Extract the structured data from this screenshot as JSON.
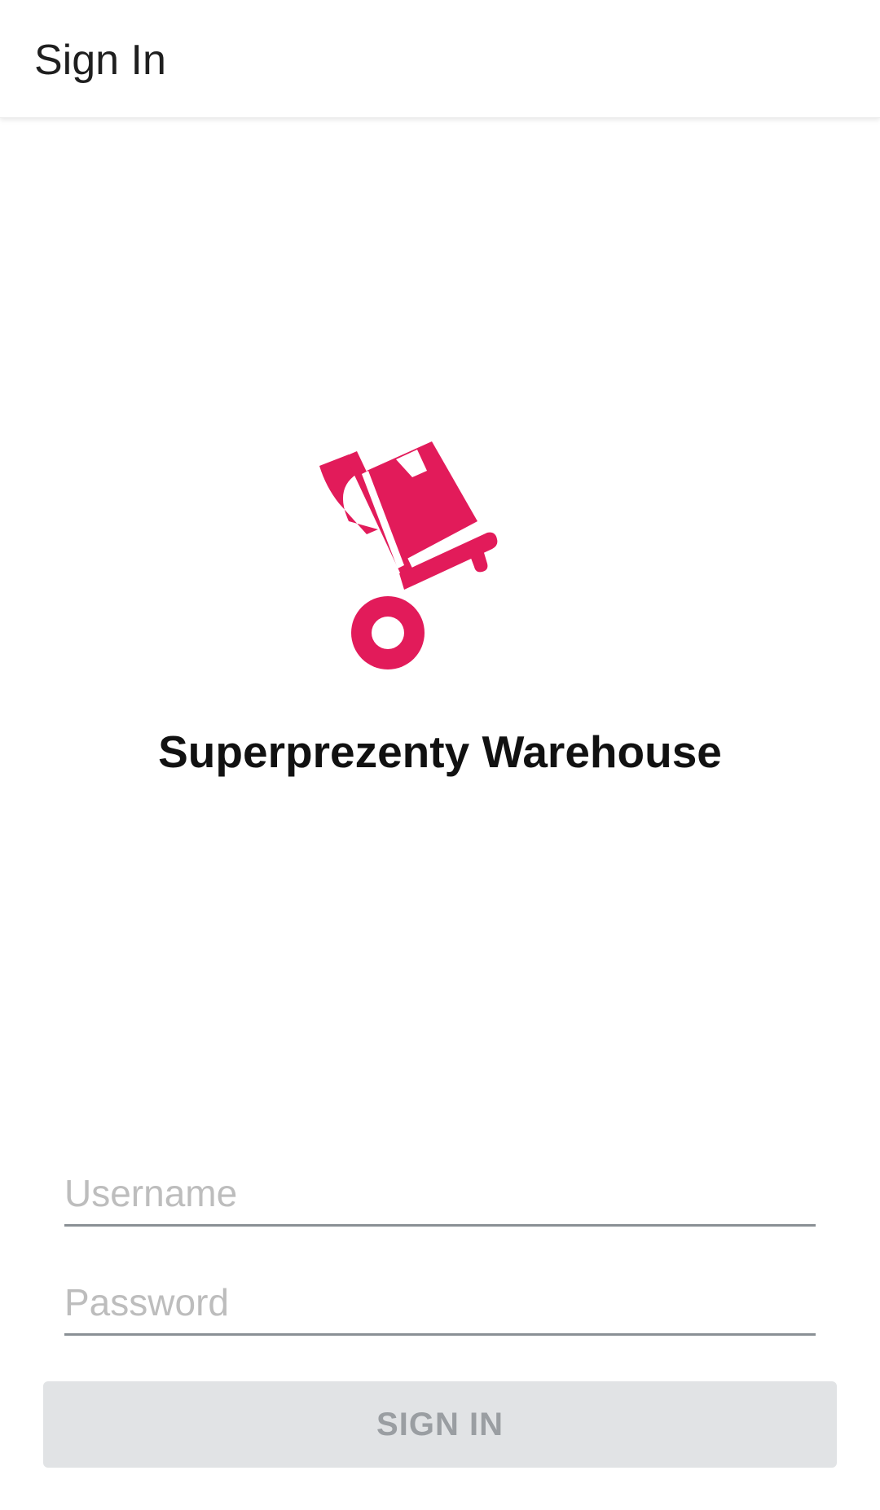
{
  "app_bar": {
    "title": "Sign In"
  },
  "branding": {
    "logo_icon": "hand-truck-box-icon",
    "logo_color": "#E21B5A",
    "app_name": "Superprezenty Warehouse"
  },
  "form": {
    "username": {
      "value": "",
      "placeholder": "Username"
    },
    "password": {
      "value": "",
      "placeholder": "Password"
    },
    "submit_label": "SIGN IN",
    "submit_enabled": false
  }
}
